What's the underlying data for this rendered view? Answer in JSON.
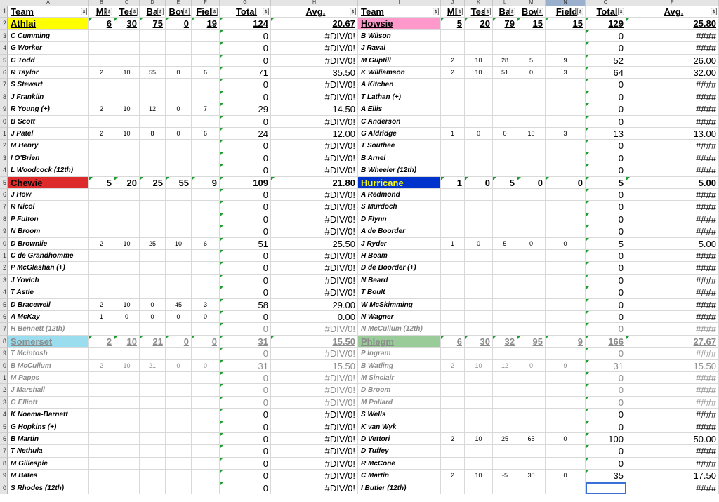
{
  "columns": [
    "A",
    "B",
    "C",
    "D",
    "E",
    "F",
    "G",
    "H",
    "I",
    "J",
    "K",
    "L",
    "M",
    "N",
    "O",
    "P"
  ],
  "row_numbers": [
    "1",
    "2",
    "3",
    "4",
    "5",
    "6",
    "7",
    "8",
    "9",
    "0",
    "1",
    "2",
    "3",
    "4",
    "5",
    "6",
    "7",
    "8",
    "9",
    "0",
    "1",
    "2",
    "3",
    "4",
    "5",
    "6",
    "7",
    "8",
    "9",
    "0",
    "1",
    "2",
    "3",
    "4",
    "5",
    "6",
    "7",
    "8",
    "9",
    "0"
  ],
  "headers": [
    "Team",
    "MP",
    "Test",
    "Bat",
    "Bowl",
    "Field",
    "Total",
    "Avg."
  ],
  "sort_icon": "⇕",
  "colors": {
    "athlai": "#ffff00",
    "howsie": "#ff99cc",
    "chewie": "#dd2a2a",
    "hurricane": "#0033cc",
    "somerset": "#99ddee",
    "phlegm": "#99cc99",
    "hurricane_text": "#ffff00",
    "green_mark": "#1e9e2e"
  },
  "left": {
    "teams": [
      {
        "name": "Athlai",
        "mp": "6",
        "test": "30",
        "bat": "75",
        "bowl": "0",
        "field": "19",
        "total": "124",
        "avg": "20.67",
        "faded": false,
        "players": [
          {
            "name": "C Cumming",
            "mp": "",
            "test": "",
            "bat": "",
            "bowl": "",
            "field": "",
            "total": "0",
            "avg": "#DIV/0!"
          },
          {
            "name": "G Worker",
            "mp": "",
            "test": "",
            "bat": "",
            "bowl": "",
            "field": "",
            "total": "0",
            "avg": "#DIV/0!"
          },
          {
            "name": "G Todd",
            "mp": "",
            "test": "",
            "bat": "",
            "bowl": "",
            "field": "",
            "total": "0",
            "avg": "#DIV/0!"
          },
          {
            "name": "R Taylor",
            "mp": "2",
            "test": "10",
            "bat": "55",
            "bowl": "0",
            "field": "6",
            "total": "71",
            "avg": "35.50"
          },
          {
            "name": "S Stewart",
            "mp": "",
            "test": "",
            "bat": "",
            "bowl": "",
            "field": "",
            "total": "0",
            "avg": "#DIV/0!"
          },
          {
            "name": "J Franklin",
            "mp": "",
            "test": "",
            "bat": "",
            "bowl": "",
            "field": "",
            "total": "0",
            "avg": "#DIV/0!"
          },
          {
            "name": "R Young (+)",
            "mp": "2",
            "test": "10",
            "bat": "12",
            "bowl": "0",
            "field": "7",
            "total": "29",
            "avg": "14.50"
          },
          {
            "name": "B Scott",
            "mp": "",
            "test": "",
            "bat": "",
            "bowl": "",
            "field": "",
            "total": "0",
            "avg": "#DIV/0!"
          },
          {
            "name": "J Patel",
            "mp": "2",
            "test": "10",
            "bat": "8",
            "bowl": "0",
            "field": "6",
            "total": "24",
            "avg": "12.00"
          },
          {
            "name": "M Henry",
            "mp": "",
            "test": "",
            "bat": "",
            "bowl": "",
            "field": "",
            "total": "0",
            "avg": "#DIV/0!"
          },
          {
            "name": "I O'Brien",
            "mp": "",
            "test": "",
            "bat": "",
            "bowl": "",
            "field": "",
            "total": "0",
            "avg": "#DIV/0!"
          },
          {
            "name": "L Woodcock (12th)",
            "mp": "",
            "test": "",
            "bat": "",
            "bowl": "",
            "field": "",
            "total": "0",
            "avg": "#DIV/0!"
          }
        ]
      },
      {
        "name": "Chewie",
        "mp": "5",
        "test": "20",
        "bat": "25",
        "bowl": "55",
        "field": "9",
        "total": "109",
        "avg": "21.80",
        "faded": false,
        "players": [
          {
            "name": "J How",
            "mp": "",
            "test": "",
            "bat": "",
            "bowl": "",
            "field": "",
            "total": "0",
            "avg": "#DIV/0!"
          },
          {
            "name": "R Nicol",
            "mp": "",
            "test": "",
            "bat": "",
            "bowl": "",
            "field": "",
            "total": "0",
            "avg": "#DIV/0!"
          },
          {
            "name": "P Fulton",
            "mp": "",
            "test": "",
            "bat": "",
            "bowl": "",
            "field": "",
            "total": "0",
            "avg": "#DIV/0!"
          },
          {
            "name": "N Broom",
            "mp": "",
            "test": "",
            "bat": "",
            "bowl": "",
            "field": "",
            "total": "0",
            "avg": "#DIV/0!"
          },
          {
            "name": "D Brownlie",
            "mp": "2",
            "test": "10",
            "bat": "25",
            "bowl": "10",
            "field": "6",
            "total": "51",
            "avg": "25.50"
          },
          {
            "name": "C de Grandhomme",
            "mp": "",
            "test": "",
            "bat": "",
            "bowl": "",
            "field": "",
            "total": "0",
            "avg": "#DIV/0!"
          },
          {
            "name": "P McGlashan (+)",
            "mp": "",
            "test": "",
            "bat": "",
            "bowl": "",
            "field": "",
            "total": "0",
            "avg": "#DIV/0!"
          },
          {
            "name": "J Yovich",
            "mp": "",
            "test": "",
            "bat": "",
            "bowl": "",
            "field": "",
            "total": "0",
            "avg": "#DIV/0!"
          },
          {
            "name": "T Astle",
            "mp": "",
            "test": "",
            "bat": "",
            "bowl": "",
            "field": "",
            "total": "0",
            "avg": "#DIV/0!"
          },
          {
            "name": "D Bracewell",
            "mp": "2",
            "test": "10",
            "bat": "0",
            "bowl": "45",
            "field": "3",
            "total": "58",
            "avg": "29.00"
          },
          {
            "name": "A McKay",
            "mp": "1",
            "test": "0",
            "bat": "0",
            "bowl": "0",
            "field": "0",
            "total": "0",
            "avg": "0.00"
          },
          {
            "name": "H Bennett (12th)",
            "mp": "",
            "test": "",
            "bat": "",
            "bowl": "",
            "field": "",
            "total": "0",
            "avg": "#DIV/0!",
            "faded": true
          }
        ]
      },
      {
        "name": "Somerset",
        "mp": "2",
        "test": "10",
        "bat": "21",
        "bowl": "0",
        "field": "0",
        "total": "31",
        "avg": "15.50",
        "faded": true,
        "players": [
          {
            "name": "T Mcintosh",
            "mp": "",
            "test": "",
            "bat": "",
            "bowl": "",
            "field": "",
            "total": "0",
            "avg": "#DIV/0!",
            "faded": true
          },
          {
            "name": "B McCullum",
            "mp": "2",
            "test": "10",
            "bat": "21",
            "bowl": "0",
            "field": "0",
            "total": "31",
            "avg": "15.50",
            "faded": true
          },
          {
            "name": "M Papps",
            "mp": "",
            "test": "",
            "bat": "",
            "bowl": "",
            "field": "",
            "total": "0",
            "avg": "#DIV/0!",
            "faded": true
          },
          {
            "name": "J Marshall",
            "mp": "",
            "test": "",
            "bat": "",
            "bowl": "",
            "field": "",
            "total": "0",
            "avg": "#DIV/0!",
            "faded": true
          },
          {
            "name": "G Elliott",
            "mp": "",
            "test": "",
            "bat": "",
            "bowl": "",
            "field": "",
            "total": "0",
            "avg": "#DIV/0!",
            "faded": true
          },
          {
            "name": "K Noema-Barnett",
            "mp": "",
            "test": "",
            "bat": "",
            "bowl": "",
            "field": "",
            "total": "0",
            "avg": "#DIV/0!"
          },
          {
            "name": "G Hopkins (+)",
            "mp": "",
            "test": "",
            "bat": "",
            "bowl": "",
            "field": "",
            "total": "0",
            "avg": "#DIV/0!"
          },
          {
            "name": "B Martin",
            "mp": "",
            "test": "",
            "bat": "",
            "bowl": "",
            "field": "",
            "total": "0",
            "avg": "#DIV/0!"
          },
          {
            "name": "T Nethula",
            "mp": "",
            "test": "",
            "bat": "",
            "bowl": "",
            "field": "",
            "total": "0",
            "avg": "#DIV/0!"
          },
          {
            "name": "M Gillespie",
            "mp": "",
            "test": "",
            "bat": "",
            "bowl": "",
            "field": "",
            "total": "0",
            "avg": "#DIV/0!"
          },
          {
            "name": "M Bates",
            "mp": "",
            "test": "",
            "bat": "",
            "bowl": "",
            "field": "",
            "total": "0",
            "avg": "#DIV/0!"
          },
          {
            "name": "S Rhodes (12th)",
            "mp": "",
            "test": "",
            "bat": "",
            "bowl": "",
            "field": "",
            "total": "0",
            "avg": "#DIV/0!"
          }
        ]
      }
    ]
  },
  "right": {
    "teams": [
      {
        "name": "Howsie",
        "mp": "5",
        "test": "20",
        "bat": "79",
        "bowl": "15",
        "field": "15",
        "total": "129",
        "avg": "25.80",
        "faded": false,
        "players": [
          {
            "name": "B Wilson",
            "mp": "",
            "test": "",
            "bat": "",
            "bowl": "",
            "field": "",
            "total": "0",
            "avg": "####"
          },
          {
            "name": "J Raval",
            "mp": "",
            "test": "",
            "bat": "",
            "bowl": "",
            "field": "",
            "total": "0",
            "avg": "####"
          },
          {
            "name": "M Guptill",
            "mp": "2",
            "test": "10",
            "bat": "28",
            "bowl": "5",
            "field": "9",
            "total": "52",
            "avg": "26.00"
          },
          {
            "name": "K Williamson",
            "mp": "2",
            "test": "10",
            "bat": "51",
            "bowl": "0",
            "field": "3",
            "total": "64",
            "avg": "32.00"
          },
          {
            "name": "A Kitchen",
            "mp": "",
            "test": "",
            "bat": "",
            "bowl": "",
            "field": "",
            "total": "0",
            "avg": "####"
          },
          {
            "name": "T Lathan (+)",
            "mp": "",
            "test": "",
            "bat": "",
            "bowl": "",
            "field": "",
            "total": "0",
            "avg": "####"
          },
          {
            "name": "A Ellis",
            "mp": "",
            "test": "",
            "bat": "",
            "bowl": "",
            "field": "",
            "total": "0",
            "avg": "####"
          },
          {
            "name": "C Anderson",
            "mp": "",
            "test": "",
            "bat": "",
            "bowl": "",
            "field": "",
            "total": "0",
            "avg": "####"
          },
          {
            "name": "G Aldridge",
            "mp": "1",
            "test": "0",
            "bat": "0",
            "bowl": "10",
            "field": "3",
            "total": "13",
            "avg": "13.00"
          },
          {
            "name": "T Southee",
            "mp": "",
            "test": "",
            "bat": "",
            "bowl": "",
            "field": "",
            "total": "0",
            "avg": "####"
          },
          {
            "name": "B Arnel",
            "mp": "",
            "test": "",
            "bat": "",
            "bowl": "",
            "field": "",
            "total": "0",
            "avg": "####"
          },
          {
            "name": "B Wheeler (12th)",
            "mp": "",
            "test": "",
            "bat": "",
            "bowl": "",
            "field": "",
            "total": "0",
            "avg": "####"
          }
        ]
      },
      {
        "name": "Hurricane",
        "mp": "1",
        "test": "0",
        "bat": "5",
        "bowl": "0",
        "field": "0",
        "total": "5",
        "avg": "5.00",
        "faded": false,
        "players": [
          {
            "name": "A Redmond",
            "mp": "",
            "test": "",
            "bat": "",
            "bowl": "",
            "field": "",
            "total": "0",
            "avg": "####"
          },
          {
            "name": "S Murdoch",
            "mp": "",
            "test": "",
            "bat": "",
            "bowl": "",
            "field": "",
            "total": "0",
            "avg": "####"
          },
          {
            "name": "D Flynn",
            "mp": "",
            "test": "",
            "bat": "",
            "bowl": "",
            "field": "",
            "total": "0",
            "avg": "####"
          },
          {
            "name": "A de Boorder",
            "mp": "",
            "test": "",
            "bat": "",
            "bowl": "",
            "field": "",
            "total": "0",
            "avg": "####"
          },
          {
            "name": "J Ryder",
            "mp": "1",
            "test": "0",
            "bat": "5",
            "bowl": "0",
            "field": "0",
            "total": "5",
            "avg": "5.00"
          },
          {
            "name": "H Boam",
            "mp": "",
            "test": "",
            "bat": "",
            "bowl": "",
            "field": "",
            "total": "0",
            "avg": "####"
          },
          {
            "name": "D de Boorder (+)",
            "mp": "",
            "test": "",
            "bat": "",
            "bowl": "",
            "field": "",
            "total": "0",
            "avg": "####"
          },
          {
            "name": "N Beard",
            "mp": "",
            "test": "",
            "bat": "",
            "bowl": "",
            "field": "",
            "total": "0",
            "avg": "####"
          },
          {
            "name": "T Boult",
            "mp": "",
            "test": "",
            "bat": "",
            "bowl": "",
            "field": "",
            "total": "0",
            "avg": "####"
          },
          {
            "name": "W McSkimming",
            "mp": "",
            "test": "",
            "bat": "",
            "bowl": "",
            "field": "",
            "total": "0",
            "avg": "####"
          },
          {
            "name": "N Wagner",
            "mp": "",
            "test": "",
            "bat": "",
            "bowl": "",
            "field": "",
            "total": "0",
            "avg": "####"
          },
          {
            "name": "N McCullum (12th)",
            "mp": "",
            "test": "",
            "bat": "",
            "bowl": "",
            "field": "",
            "total": "0",
            "avg": "####",
            "faded": true
          }
        ]
      },
      {
        "name": "Phlegm",
        "mp": "6",
        "test": "30",
        "bat": "32",
        "bowl": "95",
        "field": "9",
        "total": "166",
        "avg": "27.67",
        "faded": true,
        "players": [
          {
            "name": "P Ingram",
            "mp": "",
            "test": "",
            "bat": "",
            "bowl": "",
            "field": "",
            "total": "0",
            "avg": "####",
            "faded": true
          },
          {
            "name": "B Watling",
            "mp": "2",
            "test": "10",
            "bat": "12",
            "bowl": "0",
            "field": "9",
            "total": "31",
            "avg": "15.50",
            "faded": true
          },
          {
            "name": "M Sinclair",
            "mp": "",
            "test": "",
            "bat": "",
            "bowl": "",
            "field": "",
            "total": "0",
            "avg": "####",
            "faded": true
          },
          {
            "name": "D Broom",
            "mp": "",
            "test": "",
            "bat": "",
            "bowl": "",
            "field": "",
            "total": "0",
            "avg": "####",
            "faded": true
          },
          {
            "name": "M Pollard",
            "mp": "",
            "test": "",
            "bat": "",
            "bowl": "",
            "field": "",
            "total": "0",
            "avg": "####",
            "faded": true
          },
          {
            "name": "S Wells",
            "mp": "",
            "test": "",
            "bat": "",
            "bowl": "",
            "field": "",
            "total": "0",
            "avg": "####"
          },
          {
            "name": "K van Wyk",
            "mp": "",
            "test": "",
            "bat": "",
            "bowl": "",
            "field": "",
            "total": "0",
            "avg": "####"
          },
          {
            "name": "D Vettori",
            "mp": "2",
            "test": "10",
            "bat": "25",
            "bowl": "65",
            "field": "0",
            "total": "100",
            "avg": "50.00"
          },
          {
            "name": "D Tuffey",
            "mp": "",
            "test": "",
            "bat": "",
            "bowl": "",
            "field": "",
            "total": "0",
            "avg": "####"
          },
          {
            "name": "R McCone",
            "mp": "",
            "test": "",
            "bat": "",
            "bowl": "",
            "field": "",
            "total": "0",
            "avg": "####"
          },
          {
            "name": "C Martin",
            "mp": "2",
            "test": "10",
            "bat": "-5",
            "bowl": "30",
            "field": "0",
            "total": "35",
            "avg": "17.50"
          },
          {
            "name": "I Butler (12th)",
            "mp": "",
            "test": "",
            "bat": "",
            "bowl": "",
            "field": "",
            "total": "",
            "avg": "####"
          }
        ]
      }
    ]
  }
}
